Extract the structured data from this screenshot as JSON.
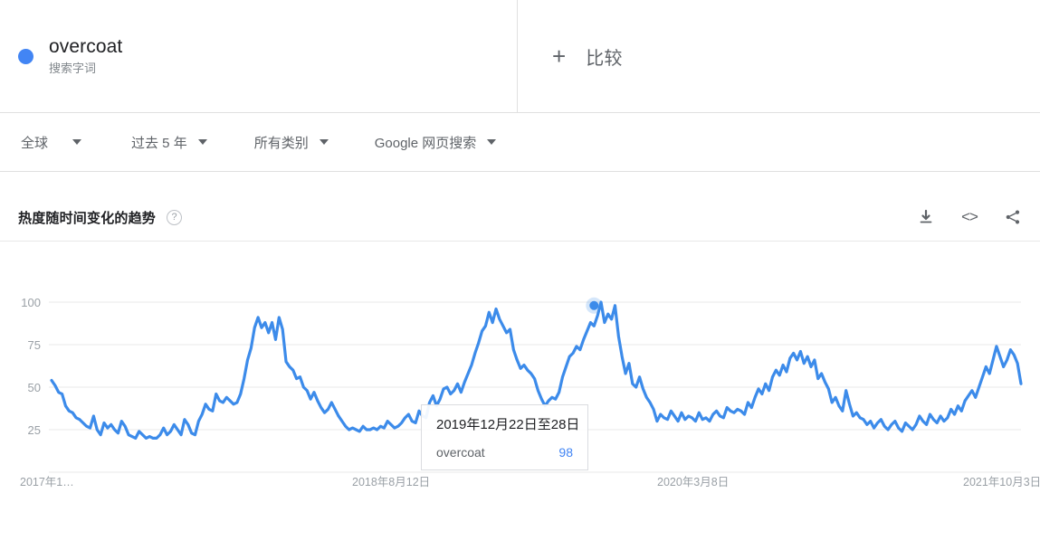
{
  "term": {
    "name": "overcoat",
    "subtitle": "搜索字词",
    "dot_color": "#4285f4"
  },
  "compare": {
    "plus": "+",
    "label": "比较"
  },
  "filters": [
    {
      "label": "全球"
    },
    {
      "label": "过去 5 年"
    },
    {
      "label": "所有类别"
    },
    {
      "label": "Google 网页搜索"
    }
  ],
  "section": {
    "title": "热度随时间变化的趋势",
    "help": "?",
    "actions": [
      {
        "name": "download-icon"
      },
      {
        "name": "embed-icon",
        "glyph": "<>"
      },
      {
        "name": "share-icon"
      }
    ]
  },
  "tooltip": {
    "date": "2019年12月22日至28日",
    "series_name": "overcoat",
    "value": "98"
  },
  "chart_data": {
    "type": "line",
    "title": "热度随时间变化的趋势",
    "xlabel": "",
    "ylabel": "",
    "ylim": [
      0,
      100
    ],
    "grid": true,
    "legend": "none",
    "line_color": "#3c8bea",
    "y_ticks": [
      100,
      75,
      50,
      25
    ],
    "x_ticks": [
      "2017年1…",
      "2018年8月12日",
      "2020年3月8日",
      "2021年10月3日"
    ],
    "highlight": {
      "index": 155,
      "value": 98,
      "label": "2019年12月22日至28日"
    },
    "series": [
      {
        "name": "overcoat",
        "values": [
          54,
          51,
          47,
          46,
          39,
          36,
          35,
          32,
          31,
          29,
          27,
          26,
          33,
          25,
          22,
          29,
          26,
          28,
          25,
          23,
          30,
          27,
          22,
          21,
          20,
          24,
          22,
          20,
          21,
          20,
          20,
          22,
          26,
          22,
          24,
          28,
          25,
          22,
          31,
          28,
          23,
          22,
          30,
          34,
          40,
          37,
          36,
          46,
          42,
          41,
          44,
          42,
          40,
          41,
          46,
          55,
          66,
          73,
          85,
          91,
          85,
          88,
          82,
          88,
          78,
          91,
          84,
          65,
          62,
          60,
          55,
          56,
          50,
          48,
          43,
          47,
          42,
          38,
          35,
          37,
          41,
          37,
          33,
          30,
          27,
          25,
          26,
          25,
          24,
          27,
          25,
          25,
          26,
          25,
          27,
          26,
          30,
          28,
          26,
          27,
          29,
          32,
          34,
          30,
          29,
          36,
          33,
          32,
          41,
          45,
          39,
          43,
          49,
          50,
          46,
          48,
          52,
          47,
          53,
          58,
          63,
          70,
          76,
          83,
          86,
          94,
          88,
          96,
          90,
          86,
          82,
          84,
          72,
          66,
          61,
          63,
          60,
          58,
          55,
          48,
          43,
          39,
          42,
          44,
          43,
          47,
          56,
          62,
          68,
          70,
          74,
          72,
          78,
          83,
          88,
          86,
          92,
          100,
          88,
          93,
          90,
          98,
          80,
          68,
          58,
          64,
          52,
          50,
          56,
          49,
          44,
          41,
          37,
          30,
          34,
          32,
          31,
          36,
          33,
          30,
          35,
          31,
          33,
          32,
          30,
          35,
          31,
          32,
          30,
          34,
          36,
          33,
          32,
          38,
          36,
          35,
          37,
          36,
          34,
          41,
          38,
          44,
          49,
          46,
          52,
          48,
          56,
          60,
          57,
          63,
          59,
          67,
          70,
          66,
          71,
          64,
          68,
          62,
          66,
          55,
          58,
          53,
          49,
          41,
          44,
          39,
          36,
          48,
          40,
          33,
          35,
          32,
          31,
          28,
          30,
          26,
          29,
          31,
          27,
          25,
          28,
          30,
          26,
          24,
          29,
          27,
          25,
          28,
          33,
          30,
          28,
          34,
          31,
          29,
          33,
          30,
          32,
          37,
          34,
          39,
          36,
          42,
          45,
          48,
          44,
          50,
          56,
          62,
          58,
          66,
          74,
          68,
          62,
          66,
          72,
          69,
          64,
          52
        ]
      }
    ]
  }
}
